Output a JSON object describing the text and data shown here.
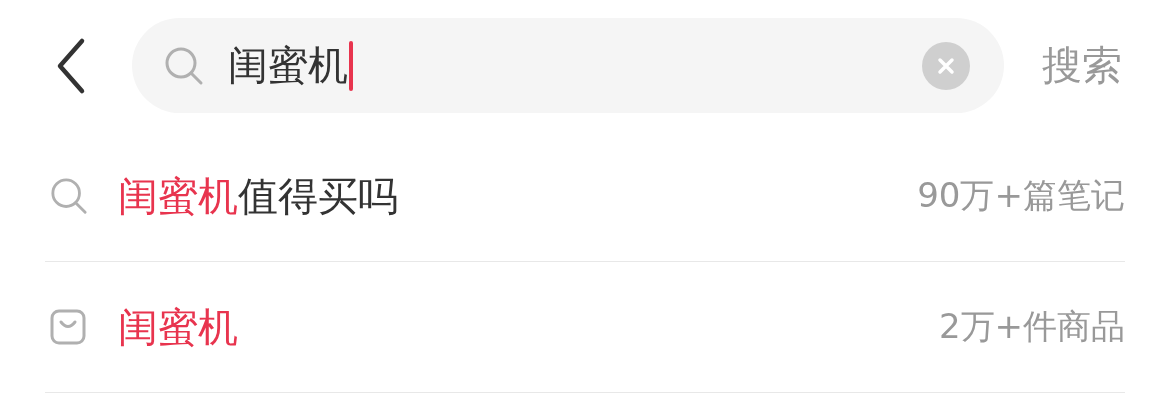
{
  "search": {
    "value": "闺蜜机",
    "focused": true,
    "action": "搜索"
  },
  "suggestions": [
    {
      "kind": "query",
      "highlight": "闺蜜机",
      "rest": "值得买吗",
      "count": "90万+篇笔记"
    },
    {
      "kind": "product",
      "highlight": "闺蜜机",
      "count": "2万+件商品"
    }
  ]
}
